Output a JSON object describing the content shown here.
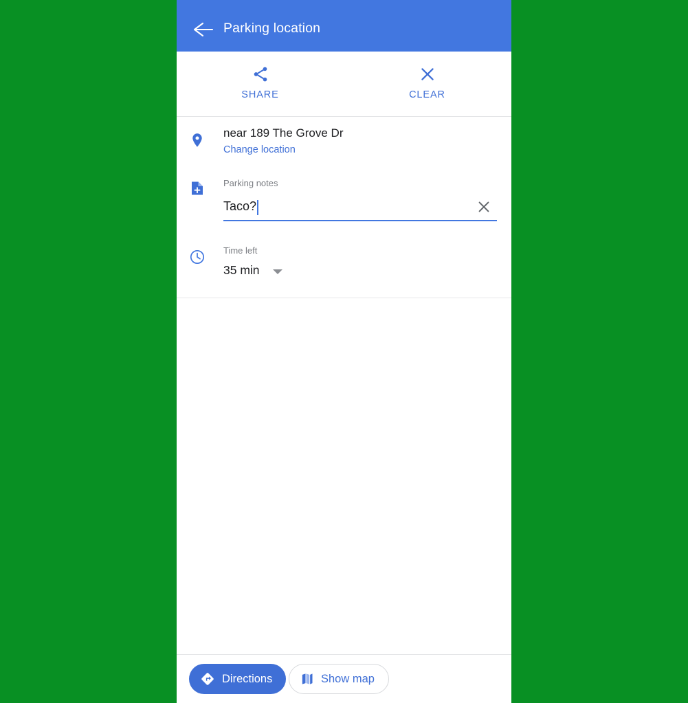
{
  "app_bar": {
    "title": "Parking location",
    "back_icon": "arrow-left-icon",
    "background_color": "#4277e0"
  },
  "action_bar": {
    "actions": [
      {
        "label": "SHARE",
        "icon": "share-icon"
      },
      {
        "label": "CLEAR",
        "icon": "close-icon"
      }
    ],
    "accent_color": "#3f6fd6"
  },
  "details": {
    "location": {
      "icon": "map-pin-icon",
      "primary_text": "near 189 The Grove Dr",
      "change_link": "Change location"
    },
    "notes": {
      "icon": "note-add-icon",
      "label": "Parking notes",
      "value": "Taco?",
      "placeholder": "Parking notes",
      "clear_icon": "close-icon"
    },
    "time_left": {
      "icon": "clock-icon",
      "label": "Time left",
      "value": "35 min",
      "dropdown_icon": "chevron-down-icon"
    }
  },
  "bottom_bar": {
    "directions": {
      "label": "Directions",
      "icon": "navigation-icon"
    },
    "show_map": {
      "label": "Show map",
      "icon": "map-icon"
    }
  },
  "colors": {
    "page_background": "#089023",
    "primary_blue": "#4277e0",
    "accent_blue": "#3f6fd6",
    "text_primary": "#202124",
    "text_secondary": "#7b7e83"
  }
}
